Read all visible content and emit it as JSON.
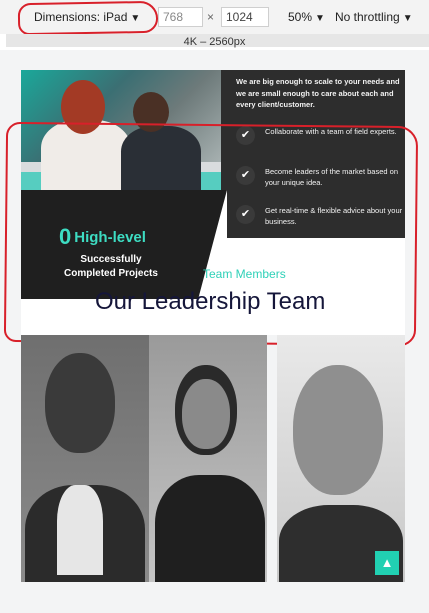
{
  "devtools": {
    "device_label": "Dimensions: iPad",
    "width": "768",
    "height": "1024",
    "separator": "×",
    "zoom": "50%",
    "throttling": "No throttling",
    "media_query": "4K – 2560px"
  },
  "hero": {
    "intro": "We are big enough to scale to your needs and we are small enough to care about each and every client/customer.",
    "features": [
      "Collaborate with a team of field experts.",
      "Become leaders of the market based on your unique idea.",
      "Get real-time & flexible advice about your business."
    ]
  },
  "stats": {
    "number": "0",
    "label": "High-level",
    "caption": "Successfully Completed Projects"
  },
  "team": {
    "subtitle": "Team Members",
    "title": "Our Leadership Team"
  },
  "colors": {
    "accent": "#2fd1b8",
    "dark": "#2d2d2d",
    "title": "#15163a",
    "annotation": "#d8202a"
  },
  "icons": {
    "check": "✔",
    "caret": "▼",
    "to_top": "chevron-up"
  }
}
